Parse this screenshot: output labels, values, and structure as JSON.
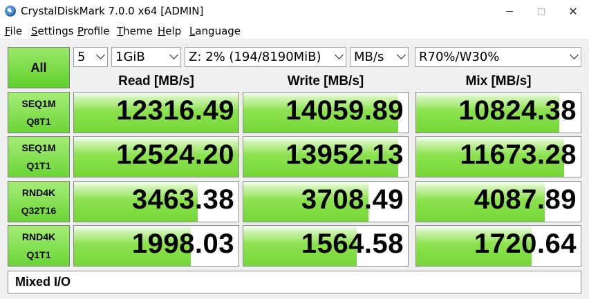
{
  "window": {
    "title": "CrystalDiskMark 7.0.0 x64 [ADMIN]",
    "icon": "crystaldiskmark-icon",
    "minimize_icon": "minimize-icon",
    "maximize_icon": "maximize-icon",
    "close_icon": "close-icon",
    "close_glyph": "✕"
  },
  "menu": {
    "file": "File",
    "settings": "Settings",
    "profile": "Profile",
    "theme": "Theme",
    "help": "Help",
    "language": "Language"
  },
  "controls": {
    "all_label": "All",
    "count": "5",
    "size": "1GiB",
    "drive": "Z: 2% (194/8190MiB)",
    "unit": "MB/s",
    "mix_ratio": "R70%/W30%"
  },
  "headers": {
    "read": "Read [MB/s]",
    "write": "Write [MB/s]",
    "mix": "Mix [MB/s]"
  },
  "tests": [
    {
      "line1": "SEQ1M",
      "line2": "Q8T1",
      "read": "12316.49",
      "write": "14059.89",
      "mix": "10824.38",
      "read_fill": 1.0,
      "write_fill": 0.94,
      "mix_fill": 0.87
    },
    {
      "line1": "SEQ1M",
      "line2": "Q1T1",
      "read": "12524.20",
      "write": "13952.13",
      "mix": "11673.28",
      "read_fill": 1.0,
      "write_fill": 0.94,
      "mix_fill": 0.9
    },
    {
      "line1": "RND4K",
      "line2": "Q32T16",
      "read": "3463.38",
      "write": "3708.49",
      "mix": "4087.89",
      "read_fill": 0.75,
      "write_fill": 0.76,
      "mix_fill": 0.78
    },
    {
      "line1": "RND4K",
      "line2": "Q1T1",
      "read": "1998.03",
      "write": "1564.58",
      "mix": "1720.64",
      "read_fill": 0.71,
      "write_fill": 0.69,
      "mix_fill": 0.7
    }
  ],
  "status": {
    "text": "Mixed I/O"
  },
  "colors": {
    "bar_green": "#74d637",
    "button_green": "#6ad535",
    "background": "#f0f0f0"
  }
}
